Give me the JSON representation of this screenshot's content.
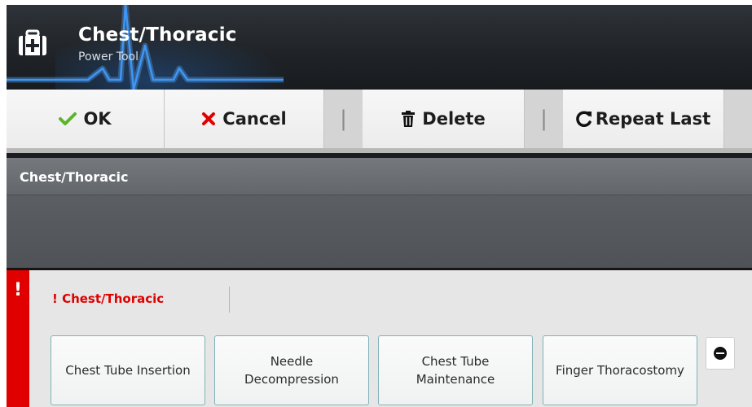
{
  "header": {
    "title": "Chest/Thoracic",
    "subtitle": "Power Tool",
    "icon": "medical-kit-icon"
  },
  "toolbar": {
    "ok_label": "OK",
    "cancel_label": "Cancel",
    "delete_label": "Delete",
    "repeat_label": "Repeat Last",
    "separator": "|",
    "icons": {
      "ok": "checkmark-icon",
      "cancel": "x-icon",
      "delete": "trash-icon",
      "repeat": "repeat-icon"
    }
  },
  "section": {
    "title": "Chest/Thoracic"
  },
  "panel": {
    "alert_mark": "!",
    "heading": "! Chest/Thoracic",
    "procedures": [
      {
        "label": "Chest Tube Insertion"
      },
      {
        "label": "Needle Decompression"
      },
      {
        "label": "Chest Tube Maintenance"
      },
      {
        "label": "Finger Thoracostomy"
      }
    ],
    "remove_icon": "minus-circle-icon"
  },
  "colors": {
    "alert_red": "#e10000",
    "ok_green": "#5ab52a",
    "cancel_red": "#e10000",
    "header_dark": "#1f2327",
    "ecg_blue": "#2f8cf0",
    "button_border": "#7fb3b8"
  }
}
